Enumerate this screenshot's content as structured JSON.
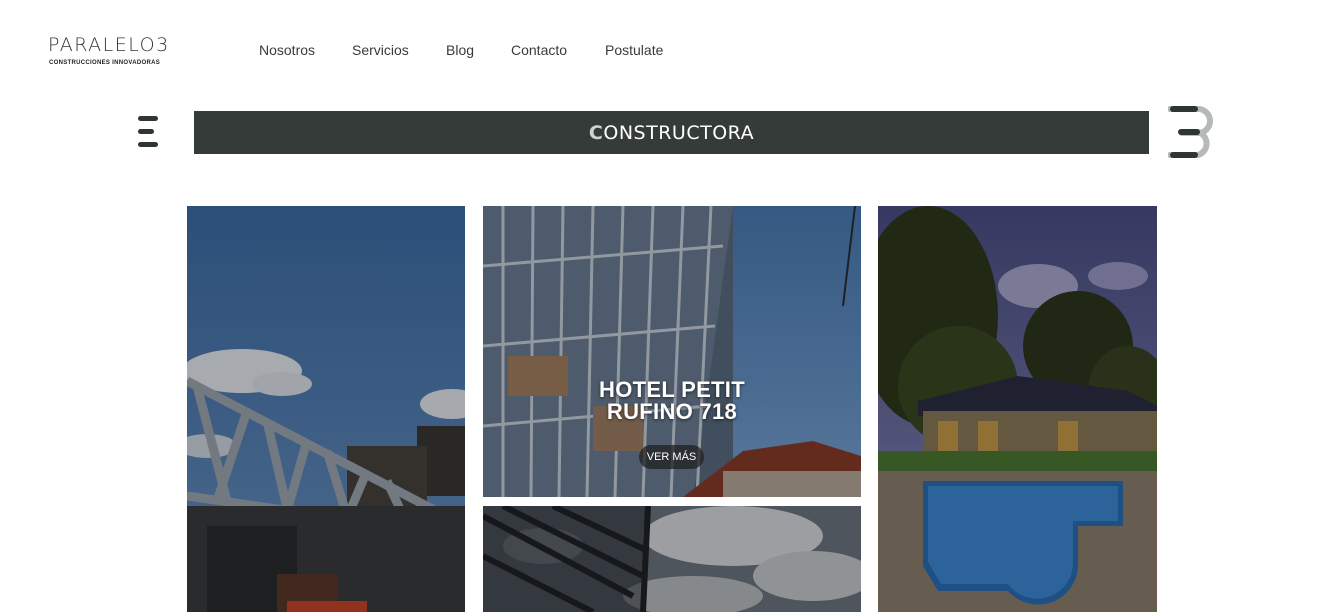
{
  "logo": {
    "name": "PARALELO3",
    "tagline": "CONSTRUCCIONES INNOVADORAS"
  },
  "nav": {
    "items": [
      {
        "label": "Nosotros"
      },
      {
        "label": "Servicios"
      },
      {
        "label": "Blog"
      },
      {
        "label": "Contacto"
      },
      {
        "label": "Postulate"
      }
    ]
  },
  "banner": {
    "title_initial": "C",
    "title_rest": "ONSTRUCTORA",
    "bar_color": "#353b39"
  },
  "gallery": {
    "projects": [
      {
        "title": "",
        "image": "steel-truss-structure"
      },
      {
        "title_line1": "HOTEL PETIT",
        "title_line2": "RUFINO 718",
        "button": "VER MÁS",
        "image": "steel-frame-building"
      },
      {
        "title": "",
        "image": "pergola-sky"
      },
      {
        "title": "",
        "image": "pool-garden-house"
      }
    ]
  }
}
